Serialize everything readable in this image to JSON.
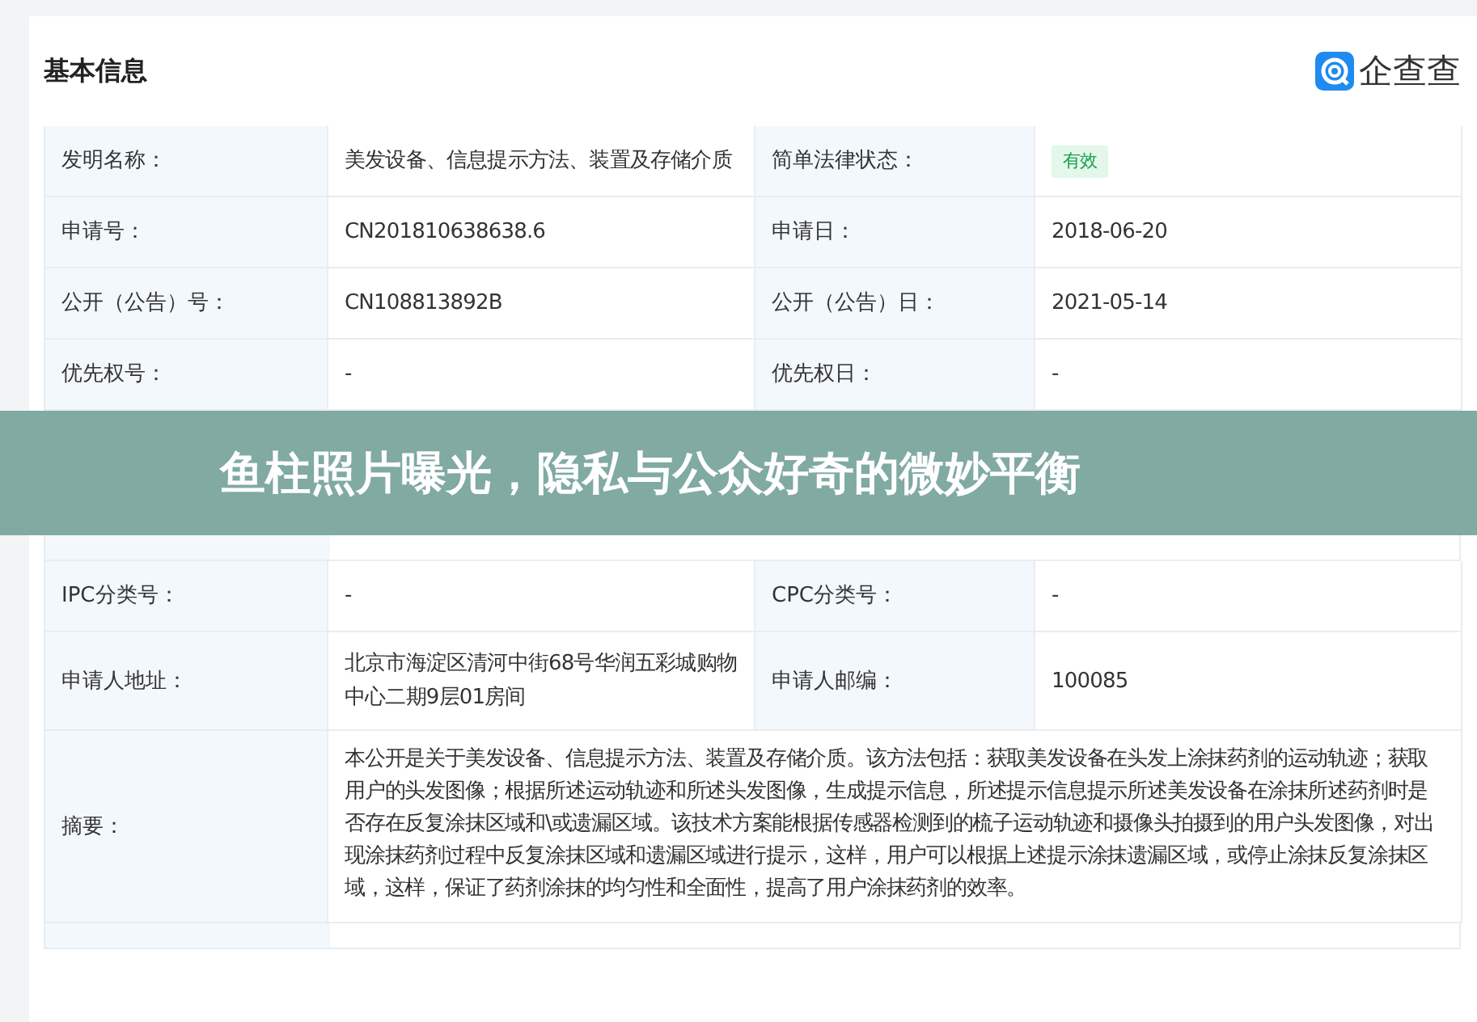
{
  "section_title": "基本信息",
  "logo": {
    "text": "企查查"
  },
  "rows_top": [
    [
      {
        "label": "发明名称：",
        "value": "美发设备、信息提示方法、装置及存储介质"
      },
      {
        "label": "简单法律状态：",
        "value": "有效",
        "kind": "badge"
      }
    ],
    [
      {
        "label": "申请号：",
        "value": "CN201810638638.6"
      },
      {
        "label": "申请日：",
        "value": "2018-06-20"
      }
    ],
    [
      {
        "label": "公开（公告）号：",
        "value": "CN108813892B"
      },
      {
        "label": "公开（公告）日：",
        "value": "2021-05-14"
      }
    ],
    [
      {
        "label": "优先权号：",
        "value": "-"
      },
      {
        "label": "优先权日：",
        "value": "-"
      }
    ]
  ],
  "banner": {
    "title": "鱼柱照片曝光，隐私与公众好奇的微妙平衡"
  },
  "rows_bottom": [
    [
      {
        "label": "IPC分类号：",
        "value": "-"
      },
      {
        "label": "CPC分类号：",
        "value": "-"
      }
    ],
    [
      {
        "label": "申请人地址：",
        "value": "北京市海淀区清河中街68号华润五彩城购物中心二期9层01房间"
      },
      {
        "label": "申请人邮编：",
        "value": "100085"
      }
    ]
  ],
  "abstract": {
    "label": "摘要：",
    "value": "本公开是关于美发设备、信息提示方法、装置及存储介质。该方法包括：获取美发设备在头发上涂抹药剂的运动轨迹；获取用户的头发图像；根据所述运动轨迹和所述头发图像，生成提示信息，所述提示信息提示所述美发设备在涂抹所述药剂时是否存在反复涂抹区域和\\或遗漏区域。该技术方案能根据传感器检测到的梳子运动轨迹和摄像头拍摄到的用户头发图像，对出现涂抹药剂过程中反复涂抹区域和遗漏区域进行提示，这样，用户可以根据上述提示涂抹遗漏区域，或停止涂抹反复涂抹区域，这样，保证了药剂涂抹的均匀性和全面性，提高了用户涂抹药剂的效率。"
  }
}
